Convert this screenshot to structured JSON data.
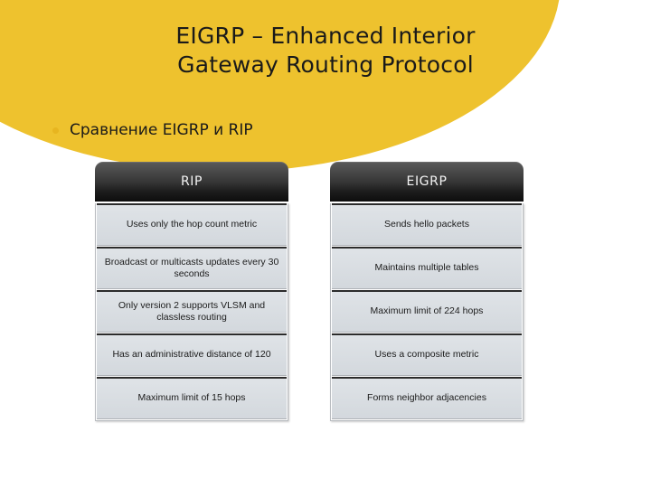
{
  "slide": {
    "title": "EIGRP – Enhanced Interior\nGateway Routing Protocol",
    "bullet": "Сравнение EIGRP и RIP",
    "accent_yellow": "#eec22e",
    "bullet_color": "#e7b520",
    "header_color": "#1d1d1d",
    "cell_color": "#d9dde2"
  },
  "tables": [
    {
      "name": "rip",
      "header": "RIP",
      "rows": [
        "Uses only the hop count metric",
        "Broadcast or multicasts updates every 30 seconds",
        "Only version 2 supports VLSM and classless routing",
        "Has an administrative distance of 120",
        "Maximum limit of 15 hops"
      ]
    },
    {
      "name": "eigrp",
      "header": "EIGRP",
      "rows": [
        "Sends hello packets",
        "Maintains multiple tables",
        "Maximum limit of 224 hops",
        "Uses a composite metric",
        "Forms neighbor adjacencies"
      ]
    }
  ]
}
